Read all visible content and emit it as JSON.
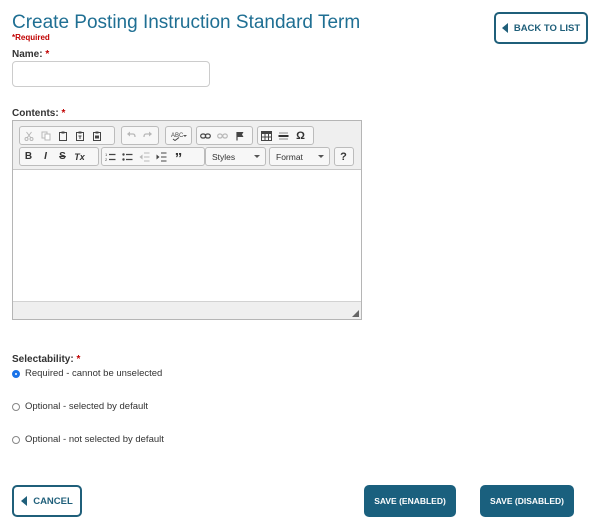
{
  "page": {
    "title": "Create Posting Instruction Standard Term",
    "required_note": "*Required"
  },
  "header": {
    "back_label": "BACK TO LIST"
  },
  "form": {
    "name_label": "Name:",
    "name_value": "",
    "contents_label": "Contents:",
    "required_star": "*",
    "selectability_label": "Selectability:",
    "options": [
      {
        "label": "Required - cannot be unselected",
        "selected": true
      },
      {
        "label": "Optional - selected by default",
        "selected": false
      },
      {
        "label": "Optional - not selected by default",
        "selected": false
      }
    ]
  },
  "editor": {
    "bold": "B",
    "italic": "I",
    "strike": "S",
    "clear_format": "Tx",
    "blockquote": "”",
    "special_char": "Ω",
    "help": "?",
    "styles_label": "Styles",
    "format_label": "Format"
  },
  "footer": {
    "cancel_label": "CANCEL",
    "save_enabled_label": "SAVE (ENABLED)",
    "save_disabled_label": "SAVE (DISABLED)"
  }
}
